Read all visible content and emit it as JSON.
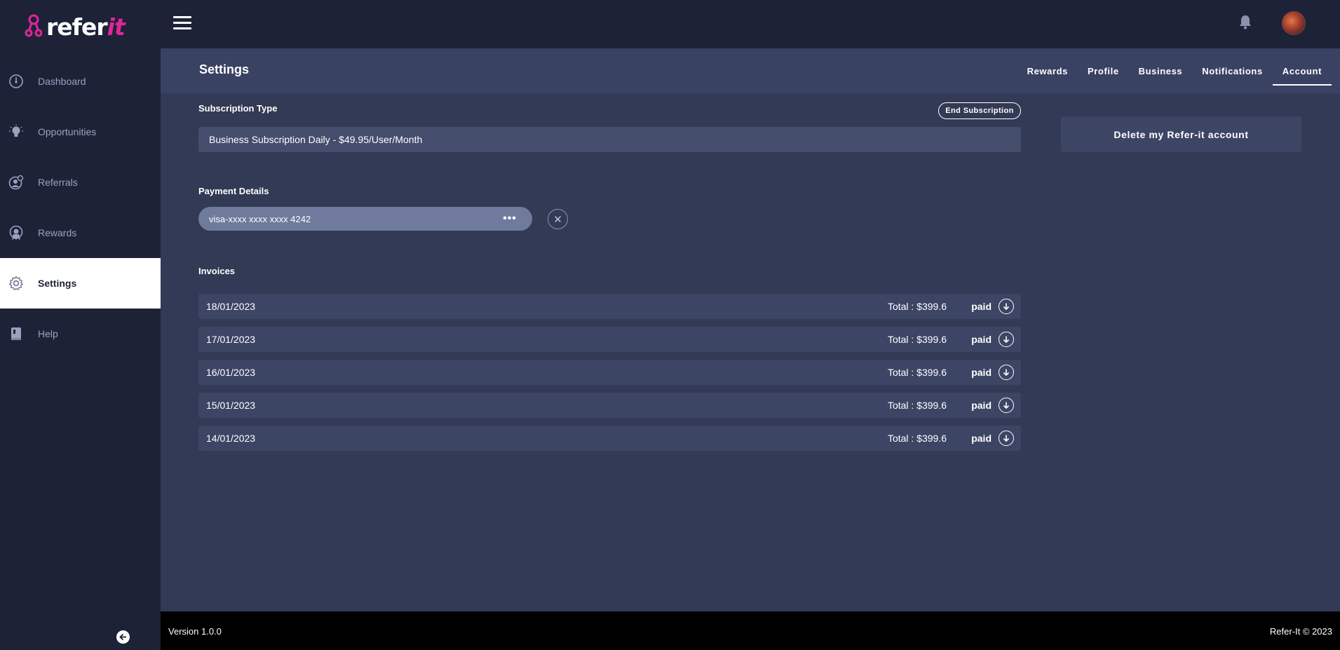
{
  "brand": {
    "name_main": "refer",
    "name_accent": "it",
    "accent_color": "#e0259b"
  },
  "sidebar": {
    "items": [
      {
        "label": "Dashboard",
        "icon": "gauge-icon"
      },
      {
        "label": "Opportunities",
        "icon": "lightbulb-icon"
      },
      {
        "label": "Referrals",
        "icon": "referrals-icon"
      },
      {
        "label": "Rewards",
        "icon": "award-icon"
      },
      {
        "label": "Settings",
        "icon": "gear-icon",
        "active": true
      },
      {
        "label": "Help",
        "icon": "book-icon"
      }
    ]
  },
  "header": {
    "menu_icon": "hamburger-icon",
    "bell_icon": "bell-icon"
  },
  "settings": {
    "title": "Settings",
    "tabs": [
      {
        "label": "Rewards"
      },
      {
        "label": "Profile"
      },
      {
        "label": "Business"
      },
      {
        "label": "Notifications"
      },
      {
        "label": "Account",
        "active": true
      }
    ]
  },
  "subscription": {
    "label": "Subscription Type",
    "end_button": "End Subscription",
    "value": "Business Subscription Daily - $49.95/User/Month"
  },
  "account": {
    "delete_label": "Delete my Refer-it account"
  },
  "payment": {
    "label": "Payment Details",
    "card": "visa-xxxx xxxx xxxx 4242",
    "menu_glyph": "•••",
    "remove_glyph": "✕"
  },
  "invoices": {
    "label": "Invoices",
    "rows": [
      {
        "date": "18/01/2023",
        "total": "Total : $399.6",
        "status": "paid"
      },
      {
        "date": "17/01/2023",
        "total": "Total : $399.6",
        "status": "paid"
      },
      {
        "date": "16/01/2023",
        "total": "Total : $399.6",
        "status": "paid"
      },
      {
        "date": "15/01/2023",
        "total": "Total : $399.6",
        "status": "paid"
      },
      {
        "date": "14/01/2023",
        "total": "Total : $399.6",
        "status": "paid"
      }
    ]
  },
  "footer": {
    "version": "Version 1.0.0",
    "copyright": "Refer-It © 2023"
  }
}
